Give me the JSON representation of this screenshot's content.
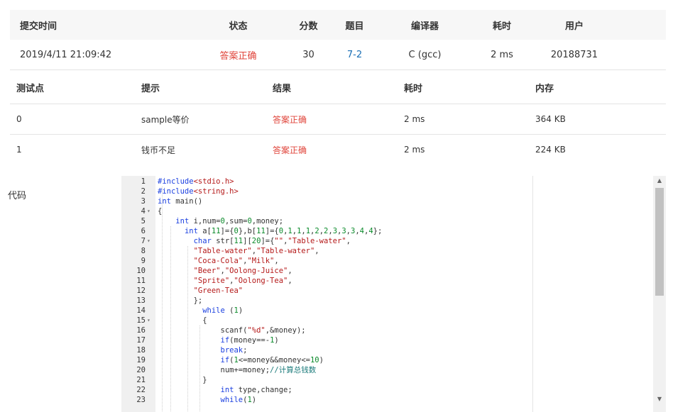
{
  "submission": {
    "headers": [
      "提交时间",
      "状态",
      "分数",
      "题目",
      "编译器",
      "耗时",
      "用户"
    ],
    "time": "2019/4/11 21:09:42",
    "status": "答案正确",
    "score": "30",
    "problem": "7-2",
    "compiler": "C (gcc)",
    "elapsed": "2 ms",
    "user": "20188731"
  },
  "testcases": {
    "headers": [
      "测试点",
      "提示",
      "结果",
      "耗时",
      "内存"
    ],
    "rows": [
      {
        "id": "0",
        "hint": "sample等价",
        "result": "答案正确",
        "time": "2 ms",
        "memory": "364 KB"
      },
      {
        "id": "1",
        "hint": "钱币不足",
        "result": "答案正确",
        "time": "2 ms",
        "memory": "224 KB"
      }
    ]
  },
  "code_label": "代码",
  "code_lines": [
    "#include<stdio.h>",
    "#include<string.h>",
    "int main()",
    "{",
    "    int i,num=0,sum=0,money;",
    "      int a[11]={0},b[11]={0,1,1,1,2,2,3,3,3,4,4};",
    "        char str[11][20]={\"\",\"Table-water\",",
    "        \"Table-water\",\"Table-water\",",
    "        \"Coca-Cola\",\"Milk\",",
    "        \"Beer\",\"Oolong-Juice\",",
    "        \"Sprite\",\"Oolong-Tea\",",
    "        \"Green-Tea\"",
    "        };",
    "          while (1)",
    "          {",
    "              scanf(\"%d\",&money);",
    "              if(money==-1)",
    "              break;",
    "              if(1<=money&&money<=10)",
    "              num+=money;//计算总钱数",
    "          }",
    "              int type,change;",
    "              while(1)"
  ]
}
